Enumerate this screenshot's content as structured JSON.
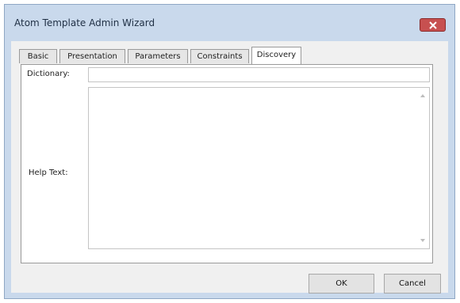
{
  "window": {
    "title": "Atom Template Admin Wizard"
  },
  "tabs": [
    {
      "label": "Basic"
    },
    {
      "label": "Presentation"
    },
    {
      "label": "Parameters"
    },
    {
      "label": "Constraints"
    },
    {
      "label": "Discovery",
      "active": true
    }
  ],
  "form": {
    "dictionary_label": "Dictionary:",
    "dictionary_value": "",
    "help_text_label": "Help Text:",
    "help_text_value": ""
  },
  "buttons": {
    "ok": "OK",
    "cancel": "Cancel"
  },
  "colors": {
    "window_frame": "#c9d9ec",
    "close_button": "#c75050",
    "client_bg": "#f0f0f0"
  },
  "icons": {
    "close": "close-icon",
    "scroll_up": "scroll-up-arrow-icon",
    "scroll_down": "scroll-down-arrow-icon"
  }
}
